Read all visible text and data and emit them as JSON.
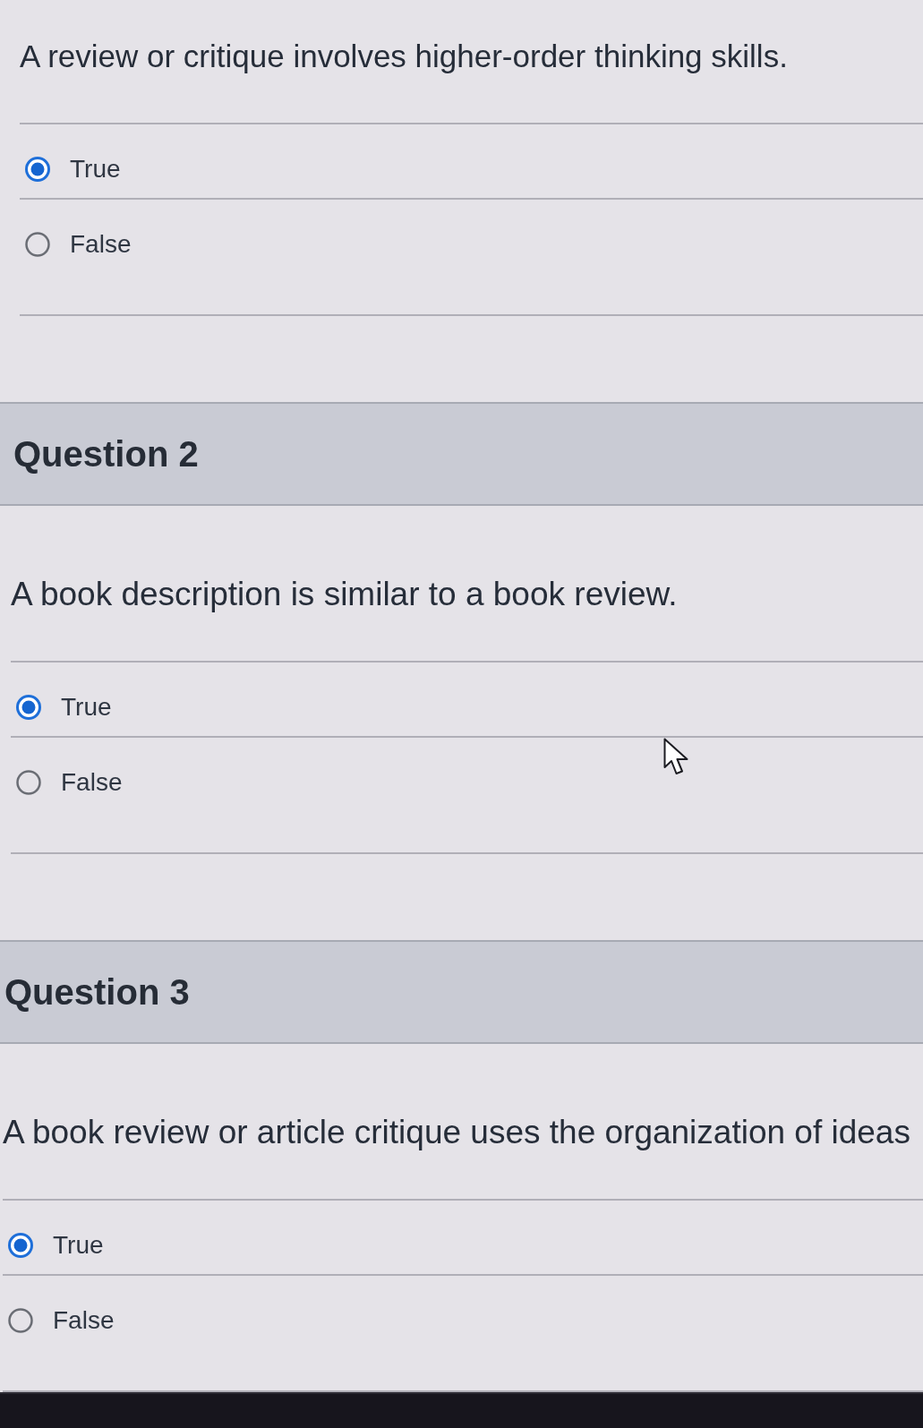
{
  "questions": [
    {
      "text": "A review or critique involves higher-order thinking skills.",
      "options": [
        {
          "label": "True",
          "selected": true
        },
        {
          "label": "False",
          "selected": false
        }
      ]
    },
    {
      "title": "Question 2",
      "text": "A book description is similar to a book review.",
      "options": [
        {
          "label": "True",
          "selected": true
        },
        {
          "label": "False",
          "selected": false
        }
      ]
    },
    {
      "title": "Question 3",
      "text": "A book review or article critique uses the organization of ideas",
      "options": [
        {
          "label": "True",
          "selected": true
        },
        {
          "label": "False",
          "selected": false
        }
      ]
    }
  ]
}
